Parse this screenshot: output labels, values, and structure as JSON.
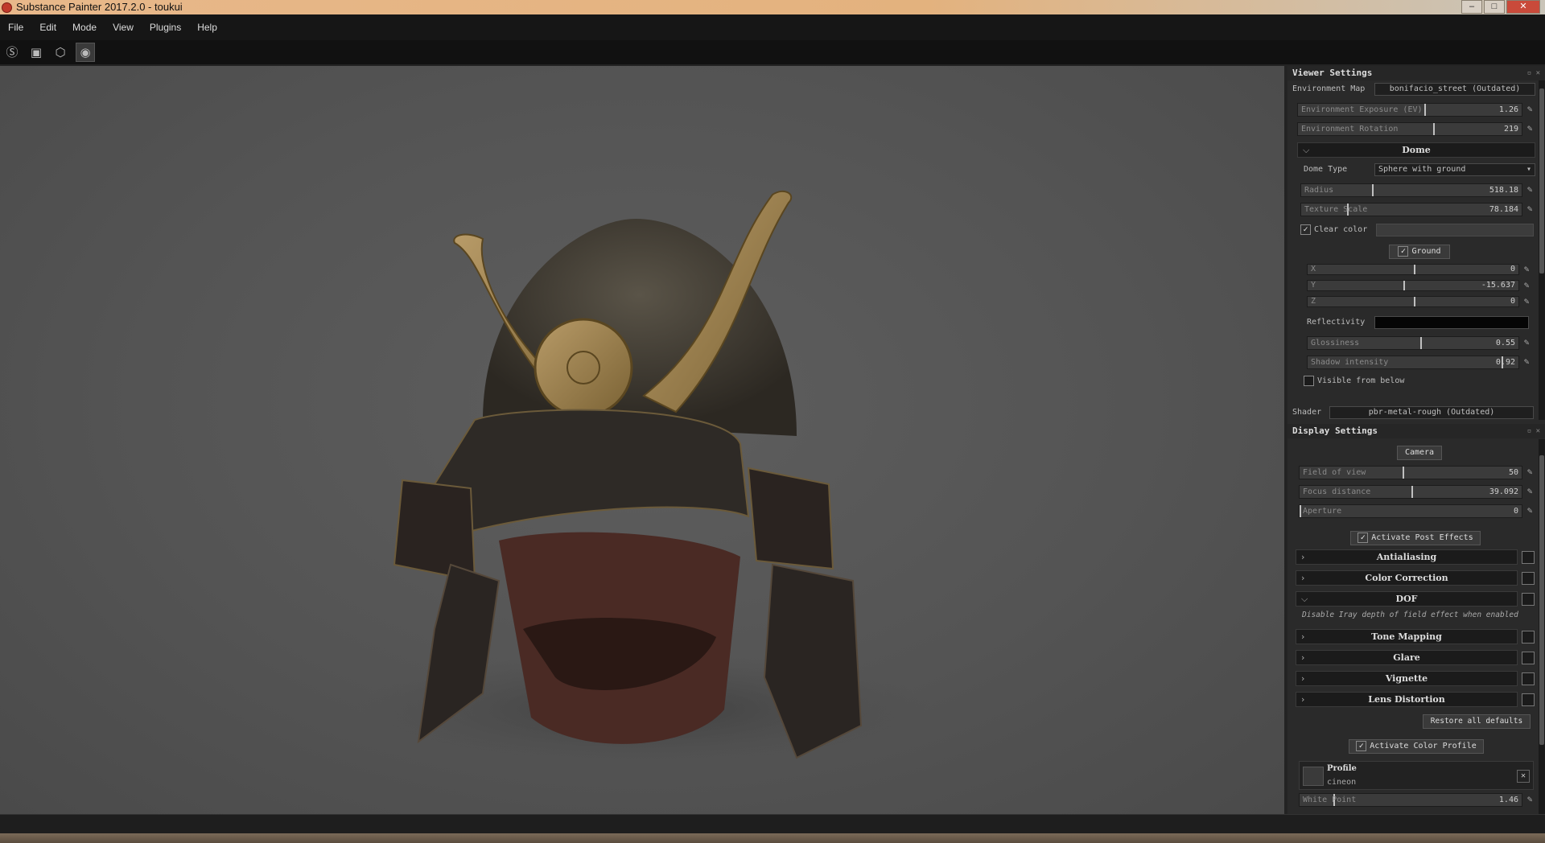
{
  "window": {
    "title": "Substance Painter 2017.2.0 - toukui"
  },
  "menu": [
    "File",
    "Edit",
    "Mode",
    "View",
    "Plugins",
    "Help"
  ],
  "viewer": {
    "title": "Viewer Settings",
    "env_map_label": "Environment Map",
    "env_map_value": "bonifacio_street (Outdated)",
    "env_exposure": {
      "label": "Environment Exposure (EV)",
      "value": "1.26",
      "fraction": 0.62
    },
    "env_rotation": {
      "label": "Environment Rotation",
      "value": "219",
      "fraction": 0.61
    },
    "dome_header": "Dome",
    "dome_type_label": "Dome Type",
    "dome_type_value": "Sphere with ground",
    "radius": {
      "label": "Radius",
      "value": "518.18",
      "fraction": 0.45
    },
    "texture_scale": {
      "label": "Texture Scale",
      "value": "78.184",
      "fraction": 0.28
    },
    "clear_color_label": "Clear color",
    "ground_label": "Ground",
    "x": {
      "label": "X",
      "value": "0",
      "fraction": 0.5
    },
    "y": {
      "label": "Y",
      "value": "-15.637",
      "fraction": 0.45
    },
    "z": {
      "label": "Z",
      "value": "0",
      "fraction": 0.5
    },
    "reflectivity_label": "Reflectivity",
    "glossiness": {
      "label": "Glossiness",
      "value": "0.55",
      "fraction": 0.55
    },
    "shadow_intensity": {
      "label": "Shadow intensity",
      "value": "0.92",
      "fraction": 0.92
    },
    "visible_from_below_label": "Visible from below",
    "shader_label": "Shader",
    "shader_value": "pbr-metal-rough (Outdated)"
  },
  "display": {
    "title": "Display Settings",
    "camera_label": "Camera",
    "field_of_view": {
      "label": "Field of view",
      "value": "50",
      "fraction": 0.46
    },
    "focus_distance": {
      "label": "Focus distance",
      "value": "39.092",
      "fraction": 0.5
    },
    "aperture": {
      "label": "Aperture",
      "value": "0",
      "fraction": 0.0
    },
    "activate_post_effects": "Activate Post Effects",
    "effects": [
      {
        "label": "Antialiasing",
        "open": false
      },
      {
        "label": "Color Correction",
        "open": false
      },
      {
        "label": "DOF",
        "open": true
      },
      {
        "label": "Tone Mapping",
        "open": false
      },
      {
        "label": "Glare",
        "open": false
      },
      {
        "label": "Vignette",
        "open": false
      },
      {
        "label": "Lens Distortion",
        "open": false
      }
    ],
    "dof_note": "Disable Iray depth of field effect when enabled",
    "restore_defaults": "Restore all defaults",
    "activate_color_profile": "Activate Color Profile",
    "profile_label": "Profile",
    "profile_value": "cineon",
    "white_point": {
      "label": "White Point",
      "value": "1.46",
      "fraction": 0.15
    }
  },
  "colors": {
    "accent": "#c0c0c0",
    "panel": "#2a2a2a",
    "viewport": "#555555"
  }
}
